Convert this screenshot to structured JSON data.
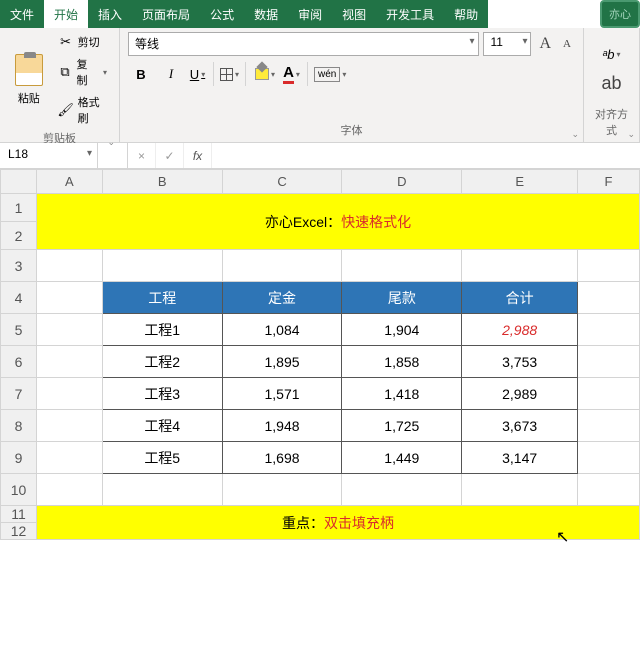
{
  "tabs": {
    "file": "文件",
    "home": "开始",
    "insert": "插入",
    "layout": "页面布局",
    "formula": "公式",
    "data": "数据",
    "review": "审阅",
    "view": "视图",
    "dev": "开发工具",
    "help": "帮助"
  },
  "helpCorner": "亦心",
  "clipboard": {
    "paste": "粘贴",
    "cut": "剪切",
    "copy": "复制",
    "format": "格式刷",
    "group": "剪贴板"
  },
  "font": {
    "name": "等线",
    "size": "11",
    "group": "字体",
    "bold": "B",
    "italic": "I",
    "underline": "U",
    "wen": "wén"
  },
  "align": {
    "group": "对齐方式",
    "ab": "ab"
  },
  "namebox": "L18",
  "fx": "fx",
  "x": "×",
  "check": "✓",
  "cols": {
    "A": "A",
    "B": "B",
    "C": "C",
    "D": "D",
    "E": "E",
    "F": "F"
  },
  "colW": {
    "A": 66,
    "B": 120,
    "C": 120,
    "D": 120,
    "E": 116,
    "F": 62
  },
  "rows": [
    "1",
    "2",
    "3",
    "4",
    "5",
    "6",
    "7",
    "8",
    "9",
    "10",
    "11",
    "12"
  ],
  "banner": {
    "t1": "亦心Excel：",
    "t2": "快速格式化"
  },
  "headers": {
    "proj": "工程",
    "dep": "定金",
    "bal": "尾款",
    "tot": "合计"
  },
  "data": [
    {
      "proj": "工程1",
      "dep": "1,084",
      "bal": "1,904",
      "tot": "2,988"
    },
    {
      "proj": "工程2",
      "dep": "1,895",
      "bal": "1,858",
      "tot": "3,753"
    },
    {
      "proj": "工程3",
      "dep": "1,571",
      "bal": "1,418",
      "tot": "2,989"
    },
    {
      "proj": "工程4",
      "dep": "1,948",
      "bal": "1,725",
      "tot": "3,673"
    },
    {
      "proj": "工程5",
      "dep": "1,698",
      "bal": "1,449",
      "tot": "3,147"
    }
  ],
  "footer": {
    "t1": "重点：",
    "t2": "双击填充柄"
  }
}
